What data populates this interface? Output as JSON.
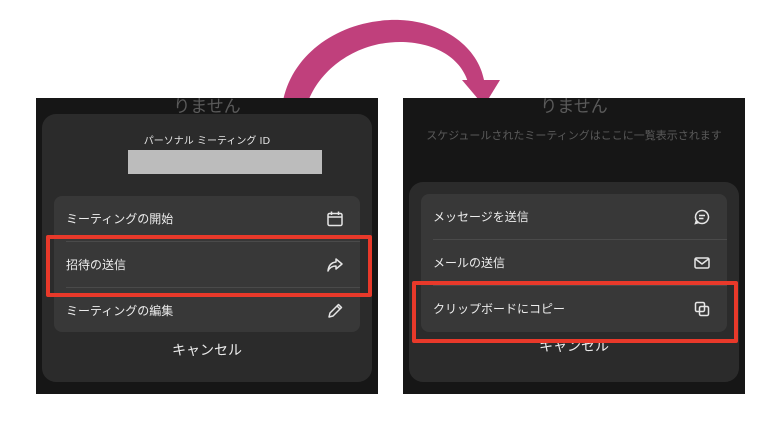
{
  "colors": {
    "arrow": "#c0407c",
    "highlight": "#e8392a",
    "sheet": "#2b2b2b",
    "group": "#383838"
  },
  "left_panel": {
    "background_title": "りません",
    "personal_meeting_id_label": "パーソナル ミーティング ID",
    "menu_items": [
      {
        "label": "ミーティングの開始",
        "icon": "calendar-icon"
      },
      {
        "label": "招待の送信",
        "icon": "share-icon"
      },
      {
        "label": "ミーティングの編集",
        "icon": "pencil-icon"
      }
    ],
    "cancel_label": "キャンセル"
  },
  "right_panel": {
    "background_title": "りません",
    "background_subtitle": "スケジュールされたミーティングはここに一覧表示されます",
    "menu_items": [
      {
        "label": "メッセージを送信",
        "icon": "message-icon"
      },
      {
        "label": "メールの送信",
        "icon": "mail-icon"
      },
      {
        "label": "クリップボードにコピー",
        "icon": "copy-icon"
      }
    ],
    "cancel_label": "キャンセル"
  }
}
